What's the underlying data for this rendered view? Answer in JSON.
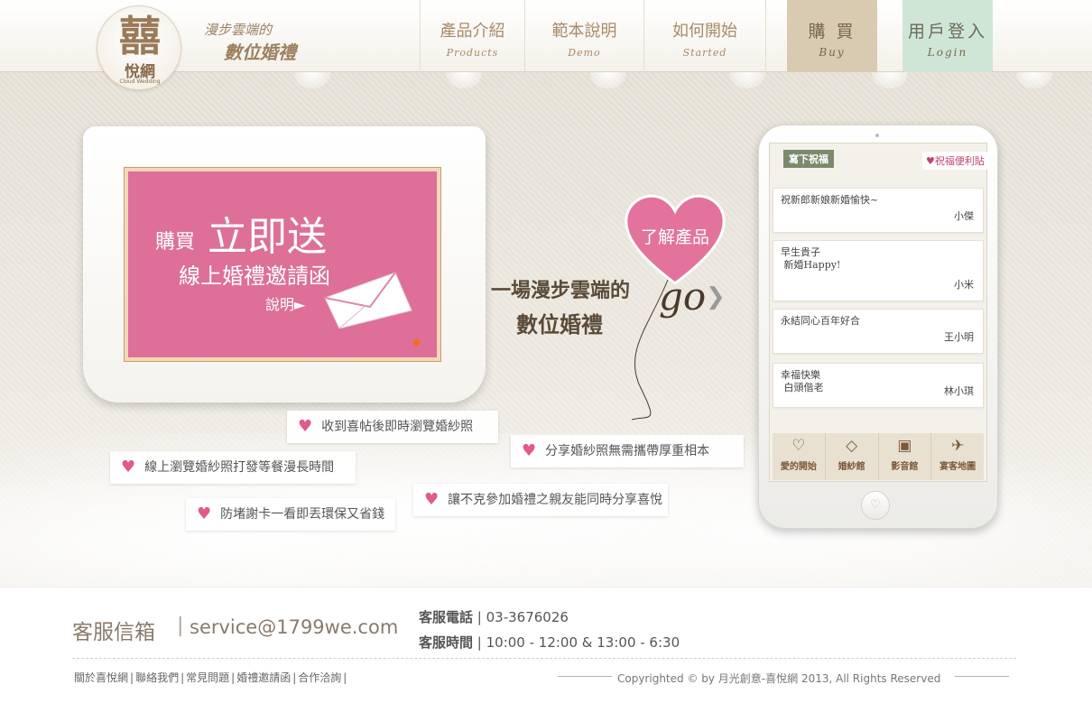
{
  "header": {
    "logo_glyph": "囍",
    "logo_name": "悅網",
    "logo_sub": "Cloud Wedding",
    "slogan_line1": "漫步雲端的",
    "slogan_line2": "數位婚禮",
    "nav": [
      {
        "zh": "產品介紹",
        "en": "Products"
      },
      {
        "zh": "範本說明",
        "en": "Demo"
      },
      {
        "zh": "如何開始",
        "en": "Started"
      }
    ],
    "buy": {
      "zh": "購 買",
      "en": "Buy"
    },
    "login": {
      "zh": "用戶登入",
      "en": "Login"
    }
  },
  "banner": {
    "buy": "購買",
    "free": "立即送",
    "invite": "線上婚禮邀請函",
    "explain": "說明►"
  },
  "tagline": {
    "line1": "一場漫步雲端的",
    "line2": "數位婚禮",
    "heart_label": "了解產品",
    "go": "go"
  },
  "features": [
    "收到喜帖後即時瀏覽婚紗照",
    "分享婚紗照無需攜帶厚重相本",
    "線上瀏覽婚紗照打發等餐漫長時間",
    "讓不克參加婚禮之親友能同時分享喜悅",
    "防堵謝卡一看即丟環保又省錢"
  ],
  "phone": {
    "tab_label": "寫下祝福",
    "sticky_label": "♥祝福便利貼",
    "messages": [
      {
        "text": "祝新郎新娘新婚愉快~",
        "author": "小傑"
      },
      {
        "text": "早生貴子\n 新婚Happy!",
        "author": "小米"
      },
      {
        "text": "永結同心百年好合",
        "author": "王小明"
      },
      {
        "text": "幸福快樂\n 白頭偕老",
        "author": "林小琪"
      }
    ],
    "bar": [
      {
        "icon": "♡",
        "label": "愛的開始"
      },
      {
        "icon": "◇",
        "label": "婚紗館"
      },
      {
        "icon": "▣",
        "label": "影音館"
      },
      {
        "icon": "✈",
        "label": "宴客地圖"
      }
    ],
    "home_icon": "♡"
  },
  "footer": {
    "mail_label": "客服信箱",
    "sep": "|",
    "mail": "service@1799we.com",
    "phone_label": "客服電話",
    "phone": "| 03-3676026",
    "hours_label": "客服時間",
    "hours": "| 10:00 - 12:00 & 13:00 - 6:30",
    "links": [
      "關於喜悅網",
      "聯絡我們",
      "常見問題",
      "婚禮邀請函",
      "合作洽詢"
    ],
    "copyright": "Copyrighted © by 月光創意-喜悅網 2013, All Rights Reserved"
  },
  "colors": {
    "accent_pink": "#dd6f98",
    "brand_brown": "#9a7a57",
    "buy_tab": "#d8cbb2",
    "login_tab": "#cfe6d6"
  }
}
